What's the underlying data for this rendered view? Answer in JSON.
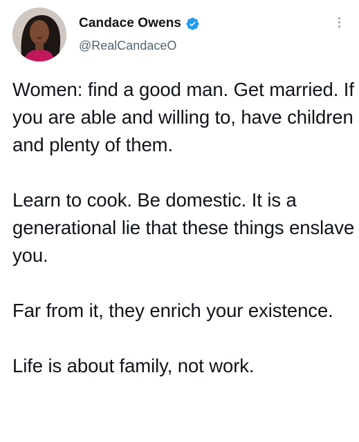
{
  "tweet": {
    "author": {
      "display_name": "Candace Owens",
      "handle": "@RealCandaceO",
      "verified_icon": "verified-badge-icon",
      "avatar_icon": "profile-photo"
    },
    "menu_icon": "more-vertical-icon",
    "paragraphs": [
      "Women: find a good man. Get married. If you are able and willing to, have children and plenty of them.",
      "Learn to cook. Be domestic. It is a generational lie that these things enslave you.",
      "Far from it, they enrich your existence.",
      "Life is about family, not work."
    ]
  },
  "colors": {
    "text": "#0f1419",
    "handle": "#536471",
    "verified": "#1d9bf0",
    "background": "#ffffff"
  }
}
